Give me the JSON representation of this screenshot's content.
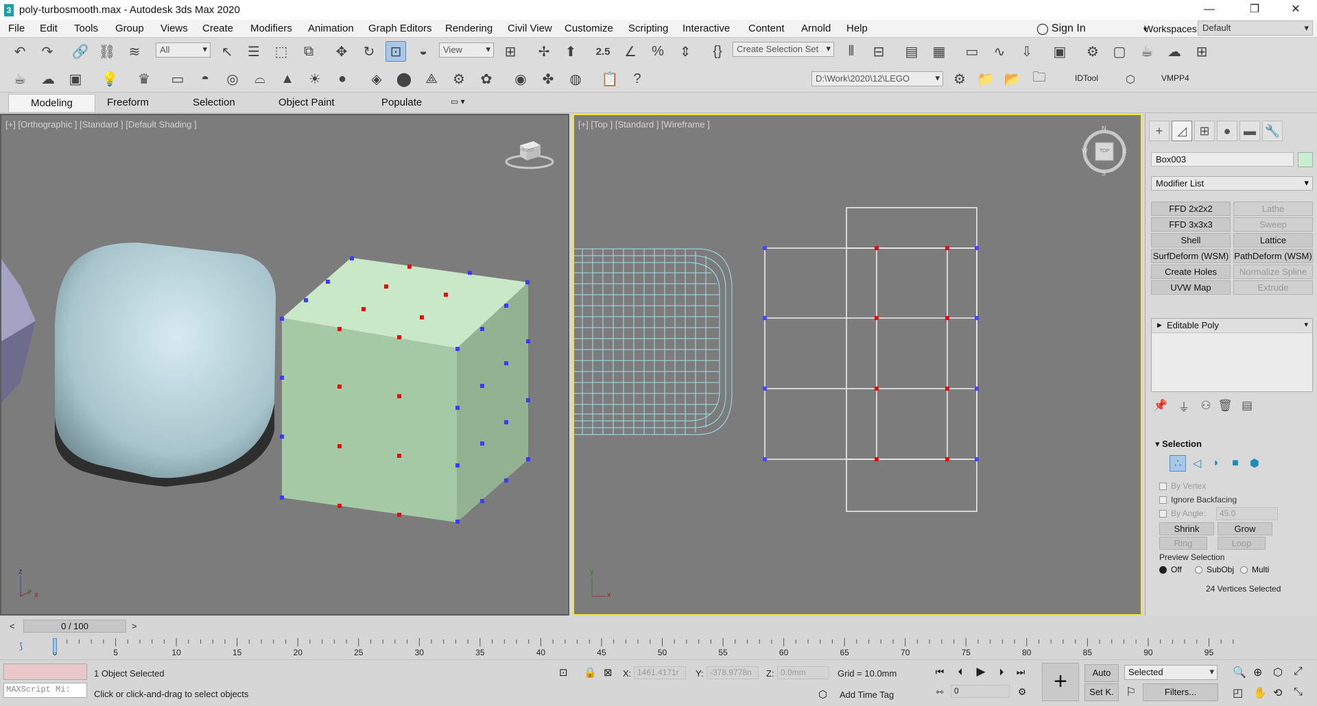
{
  "window": {
    "title": "poly-turbosmooth.max - Autodesk 3ds Max 2020",
    "app_icon": "3",
    "minimize": "—",
    "maximize": "❐",
    "close": "✕"
  },
  "menu": [
    "File",
    "Edit",
    "Tools",
    "Group",
    "Views",
    "Create",
    "Modifiers",
    "Animation",
    "Graph Editors",
    "Rendering",
    "Civil View",
    "Customize",
    "Scripting",
    "Interactive",
    "Content",
    "Arnold",
    "Help"
  ],
  "signin": "Sign In",
  "workspaces": {
    "label": "Workspaces:",
    "value": "Default"
  },
  "toolbar": {
    "filter": "All",
    "refcoord": "View",
    "selection_set": "Create Selection Set",
    "snap_label": "2.5",
    "project_path": "D:\\Work\\2020\\12\\LEGO",
    "axis_x": "X",
    "axis_y": "Y",
    "axis_z": "Z",
    "axis_xy": "XY",
    "axis_xy2": "XY",
    "idtool": "IDTool",
    "vmpp4": "VMPP4"
  },
  "ribbon": {
    "tabs": [
      "Modeling",
      "Freeform",
      "Selection",
      "Object Paint",
      "Populate"
    ]
  },
  "viewports": {
    "left_label": "[+] [Orthographic ] [Standard ] [Default Shading ]",
    "right_label": "[+] [Top ] [Standard ] [Wireframe ]",
    "viewcube_left": "FRONT",
    "viewcube_right": "TOP",
    "compass": {
      "n": "N",
      "s": "S",
      "e": "E",
      "w": "W"
    },
    "axis_x": "x",
    "axis_y": "y",
    "axis_z": "z"
  },
  "command_panel": {
    "object_name": "Box003",
    "object_color": "#c5efcf",
    "modifier_list": "Modifier List",
    "modifier_buttons": [
      {
        "label": "FFD 2x2x2",
        "enabled": true
      },
      {
        "label": "Lathe",
        "enabled": false
      },
      {
        "label": "FFD 3x3x3",
        "enabled": true
      },
      {
        "label": "Sweep",
        "enabled": false
      },
      {
        "label": "Shell",
        "enabled": true
      },
      {
        "label": "Lattice",
        "enabled": true
      },
      {
        "label": "SurfDeform (WSM)",
        "enabled": true
      },
      {
        "label": "PathDeform (WSM)",
        "enabled": true
      },
      {
        "label": "Create Holes",
        "enabled": true
      },
      {
        "label": "Normalize Spline",
        "enabled": false
      },
      {
        "label": "UVW Map",
        "enabled": true
      },
      {
        "label": "Extrude",
        "enabled": false
      }
    ],
    "stack": [
      "Editable Poly"
    ],
    "selection": {
      "title": "Selection",
      "by_vertex": "By Vertex",
      "ignore_backfacing": "Ignore Backfacing",
      "by_angle": "By Angle:",
      "angle_value": "45.0",
      "shrink": "Shrink",
      "grow": "Grow",
      "ring": "Ring",
      "loop": "Loop",
      "preview_title": "Preview Selection",
      "preview_options": [
        "Off",
        "SubObj",
        "Multi"
      ],
      "preview_selected": "Off",
      "status": "24 Vertices Selected"
    }
  },
  "timeline": {
    "frame": "0 / 100",
    "prev": "<",
    "next": ">",
    "ticks": [
      "0",
      "5",
      "10",
      "15",
      "20",
      "25",
      "30",
      "35",
      "40",
      "45",
      "50",
      "55",
      "60",
      "65",
      "70",
      "75",
      "80",
      "85",
      "90",
      "95",
      "100"
    ]
  },
  "status": {
    "maxscript": "MAXScript Mi:",
    "objects_selected": "1 Object Selected",
    "prompt": "Click or click-and-drag to select objects",
    "x_label": "X:",
    "x_value": "1461.4171r",
    "y_label": "Y:",
    "y_value": "-378.9778n",
    "z_label": "Z:",
    "z_value": "0.0mm",
    "grid": "Grid = 10.0mm",
    "add_time_tag": "Add Time Tag",
    "auto": "Auto",
    "set_key": "Set K.",
    "selected": "Selected",
    "filters": "Filters...",
    "frame_value": "0"
  }
}
